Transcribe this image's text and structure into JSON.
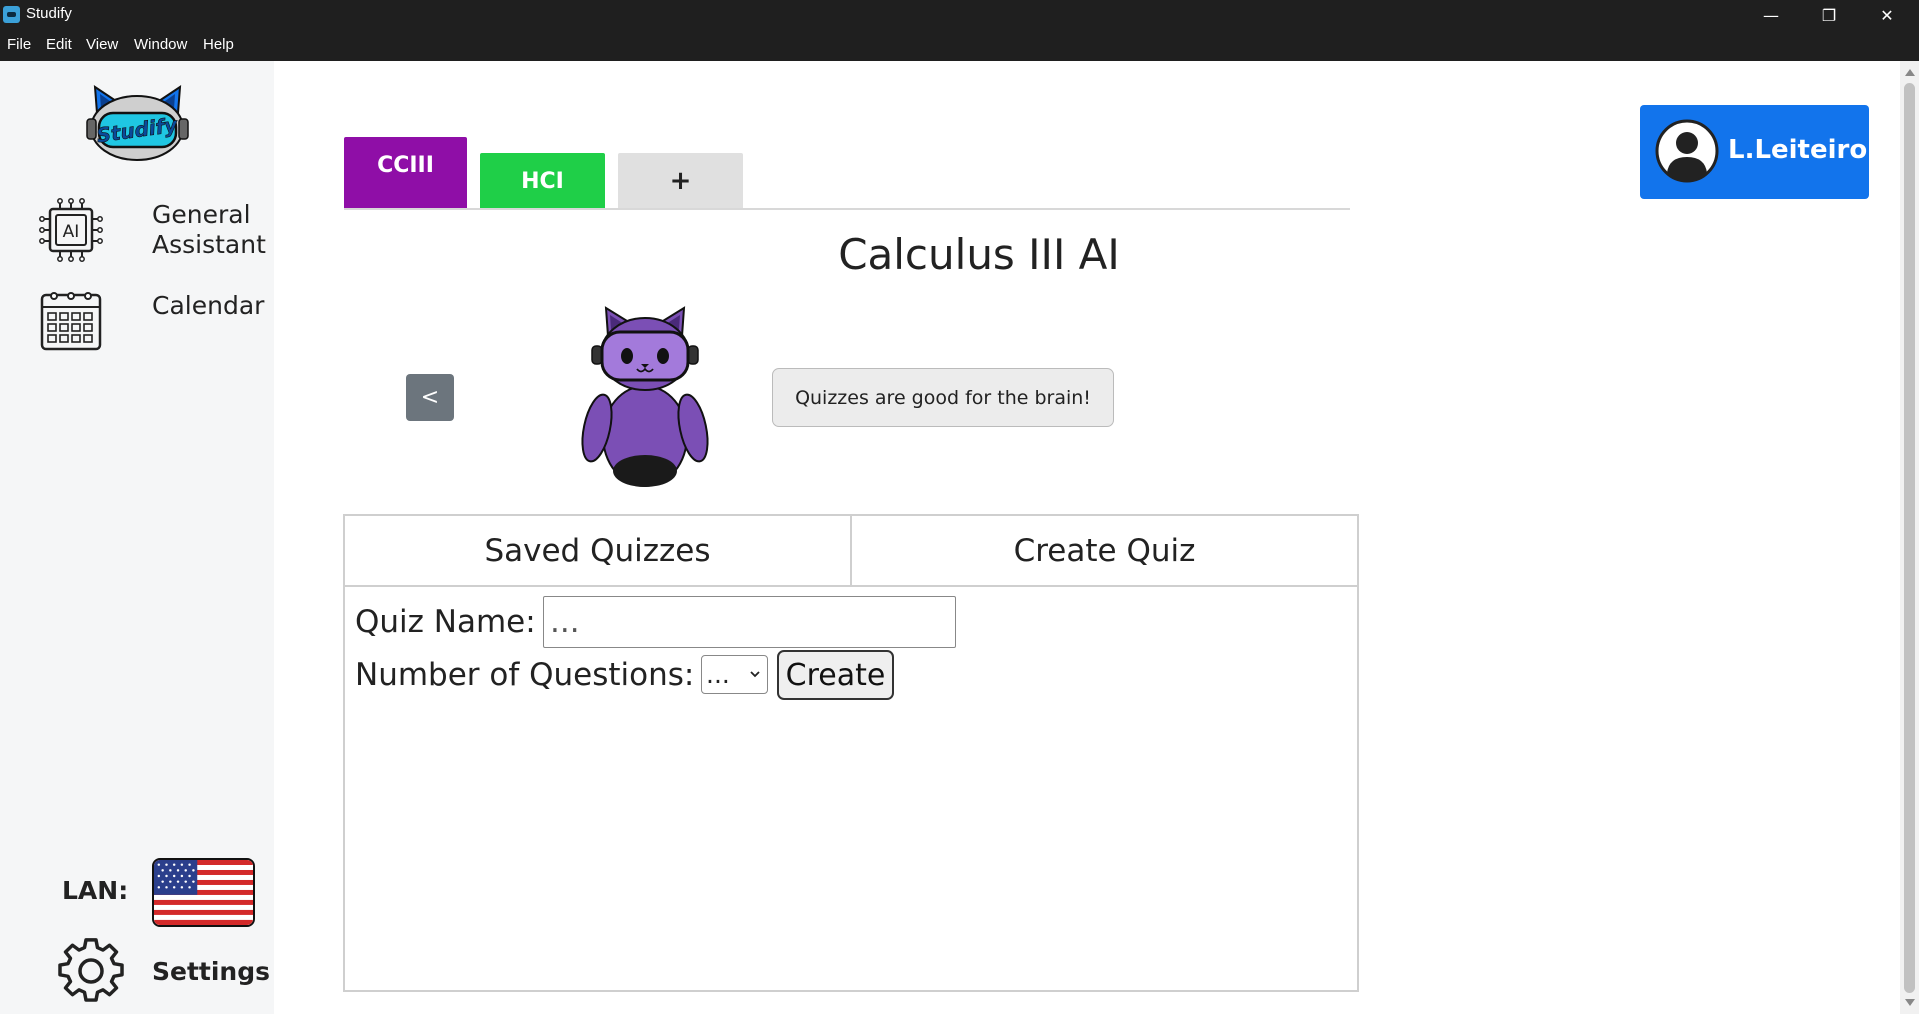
{
  "window": {
    "title": "Studify",
    "minimize_glyph": "—",
    "maximize_glyph": "❐",
    "close_glyph": "✕"
  },
  "menu": {
    "items": [
      "File",
      "Edit",
      "View",
      "Window",
      "Help"
    ]
  },
  "sidebar": {
    "logo_text": "Studify",
    "items": [
      {
        "label": "General Assistant",
        "icon": "ai-chip-icon"
      },
      {
        "label": "Calendar",
        "icon": "calendar-icon"
      }
    ],
    "ai_icon_text": "AI",
    "lan_label": "LAN:",
    "language_flag": "us-flag",
    "settings_label": "Settings"
  },
  "tabs": [
    {
      "label": "CCIII",
      "color": "#8f0ea7",
      "active": true
    },
    {
      "label": "HCI",
      "color": "#1fcf48",
      "active": false
    },
    {
      "label": "+",
      "color": "#e0e0e0",
      "active": false
    }
  ],
  "main": {
    "title": "Calculus III AI",
    "back_label": "<",
    "speech": "Quizzes are good for the brain!"
  },
  "user": {
    "name": "L.Leiteiro",
    "accent": "#1274ec"
  },
  "quiz": {
    "tabs": [
      "Saved Quizzes",
      "Create Quiz"
    ],
    "name_label": "Quiz Name:",
    "name_placeholder": "...",
    "questions_label": "Number of Questions:",
    "questions_selected": "...",
    "create_label": "Create"
  }
}
